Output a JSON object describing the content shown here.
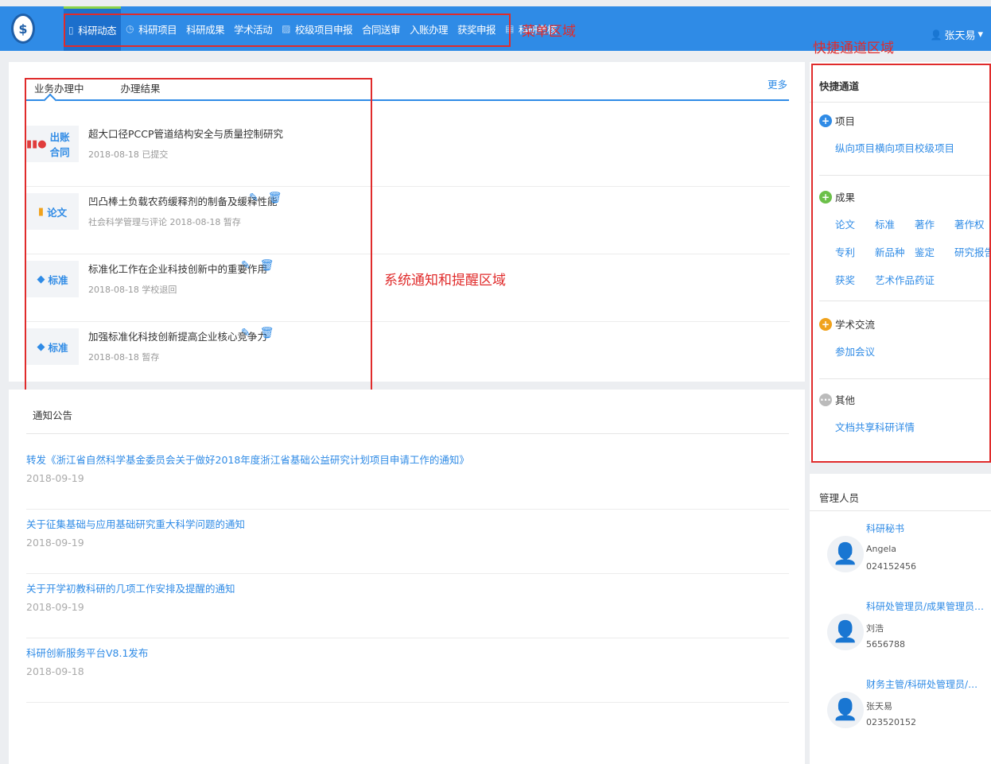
{
  "topbar": {
    "logo_glyph": "$",
    "nav": [
      {
        "label": "科研动态",
        "icon": "document-icon",
        "glyph": "▯",
        "active": true
      },
      {
        "label": "科研项目",
        "icon": "clock-icon",
        "glyph": "◷",
        "active": false
      },
      {
        "label": "科研成果",
        "icon": "",
        "glyph": "",
        "active": false
      },
      {
        "label": "学术活动",
        "icon": "",
        "glyph": "",
        "active": false
      },
      {
        "label": "校级项目申报",
        "icon": "edit-icon",
        "glyph": "▨",
        "active": false
      },
      {
        "label": "合同送审",
        "icon": "",
        "glyph": "",
        "active": false
      },
      {
        "label": "入账办理",
        "icon": "",
        "glyph": "",
        "active": false
      },
      {
        "label": "获奖申报",
        "icon": "",
        "glyph": "",
        "active": false
      },
      {
        "label": "科研考核",
        "icon": "clipboard-icon",
        "glyph": "▤",
        "active": false
      }
    ],
    "menu_annotation": "菜单区域",
    "user": {
      "icon_glyph": "👤",
      "name": "张天易",
      "caret": "▾"
    }
  },
  "tasks": {
    "tabs": [
      {
        "label": "业务办理中",
        "active": true
      },
      {
        "label": "办理结果",
        "active": false
      }
    ],
    "more": "更多",
    "annotation": "系统通知和提醒区域",
    "items": [
      {
        "badge": "出账合同",
        "badge_glyph": "▮▮●",
        "badge_color": "#e03c3c",
        "title": "超大口径PCCP管道结构安全与质量控制研究",
        "meta": "2018-08-18 已提交",
        "actions": false
      },
      {
        "badge": "论文",
        "badge_glyph": "▮",
        "badge_color": "#f0a21c",
        "title": "凹凸棒土负载农药缓释剂的制备及缓释性能",
        "meta": "社会科学管理与评论 2018-08-18 暂存",
        "actions": true
      },
      {
        "badge": "标准",
        "badge_glyph": "◆",
        "badge_color": "#2f8be6",
        "title": "标准化工作在企业科技创新中的重要作用",
        "meta": "2018-08-18 学校退回",
        "actions": true
      },
      {
        "badge": "标准",
        "badge_glyph": "◆",
        "badge_color": "#2f8be6",
        "title": "加强标准化科技创新提高企业核心竞争力",
        "meta": "2018-08-18 暂存",
        "actions": true
      }
    ],
    "edit_glyph": "✎",
    "delete_glyph": "🗑"
  },
  "notices": {
    "title": "通知公告",
    "items": [
      {
        "title": "转发《浙江省自然科学基金委员会关于做好2018年度浙江省基础公益研究计划项目申请工作的通知》",
        "date": "2018-09-19"
      },
      {
        "title": "关于征集基础与应用基础研究重大科学问题的通知",
        "date": "2018-09-19"
      },
      {
        "title": "关于开学初教科研的几项工作安排及提醒的通知",
        "date": "2018-09-19"
      },
      {
        "title": "科研创新服务平台V8.1发布",
        "date": "2018-09-18"
      }
    ]
  },
  "quick": {
    "title": "快捷通道",
    "annotation": "快捷通道区域",
    "groups": [
      {
        "label": "项目",
        "glyph": "+",
        "color": "#2f8be6",
        "links": [
          "纵向项目",
          "横向项目",
          "校级项目"
        ]
      },
      {
        "label": "成果",
        "glyph": "+",
        "color": "#6cc04a",
        "links": [
          "论文",
          "标准",
          "著作",
          "著作权",
          "专利",
          "新品种",
          "鉴定",
          "研究报告",
          "获奖",
          "艺术作品",
          "药证"
        ]
      },
      {
        "label": "学术交流",
        "glyph": "+",
        "color": "#f0a21c",
        "links": [
          "参加会议"
        ]
      },
      {
        "label": "其他",
        "glyph": "···",
        "color": "#bbbbbb",
        "links": [
          "文档共享",
          "科研详情"
        ]
      }
    ]
  },
  "managers": {
    "title": "管理人员",
    "avatar_glyph": "👤",
    "items": [
      {
        "role": "科研秘书",
        "name": "Angela",
        "phone": "024152456"
      },
      {
        "role": "科研处管理员/成果管理员/...",
        "name": "刘浩",
        "phone": "5656788"
      },
      {
        "role": "财务主管/科研处管理员/成...",
        "name": "张天易",
        "phone": "023520152"
      }
    ]
  }
}
